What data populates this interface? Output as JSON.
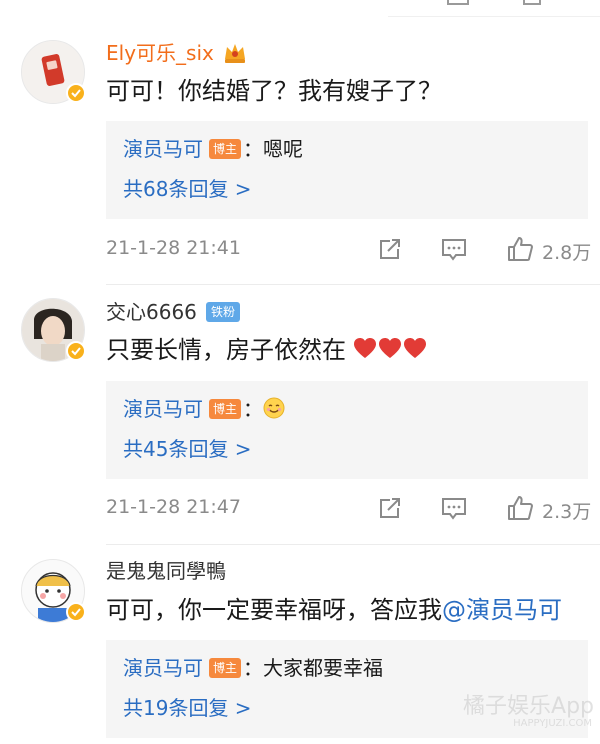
{
  "comments": [
    {
      "username": "Ely可乐_six",
      "text": "可可！你结婚了？我有嫂子了？",
      "reply": {
        "author": "演员马可",
        "badge": "博主",
        "text": "：嗯呢",
        "count_label": "共68条回复 >"
      },
      "time": "21-1-28 21:41",
      "likes": "2.8万"
    },
    {
      "username": "交心6666",
      "fan_badge": "铁粉",
      "text": "只要长情，房子依然在",
      "reply": {
        "author": "演员马可",
        "badge": "博主",
        "text": "：",
        "count_label": "共45条回复 >"
      },
      "time": "21-1-28 21:47",
      "likes": "2.3万"
    },
    {
      "username": "是鬼鬼同學鴨",
      "text": "可可，你一定要幸福呀，答应我",
      "mention": "@演员马可",
      "reply": {
        "author": "演员马可",
        "badge": "博主",
        "text": "：大家都要幸福",
        "count_label": "共19条回复 >"
      }
    }
  ],
  "watermark": {
    "title": "橘子娱乐App",
    "url": "HAPPYJUZI.COM"
  },
  "colors": {
    "link": "#2a6dc2",
    "vip_name": "#f26d1b",
    "verified": "#f9b11b",
    "bozhu": "#f6893d",
    "fan": "#5fa8e8"
  },
  "icons": [
    "crown-icon",
    "verified-badge-icon",
    "repost-icon",
    "comment-icon",
    "like-icon",
    "heart-emoji-icon",
    "smile-emoji-icon"
  ]
}
